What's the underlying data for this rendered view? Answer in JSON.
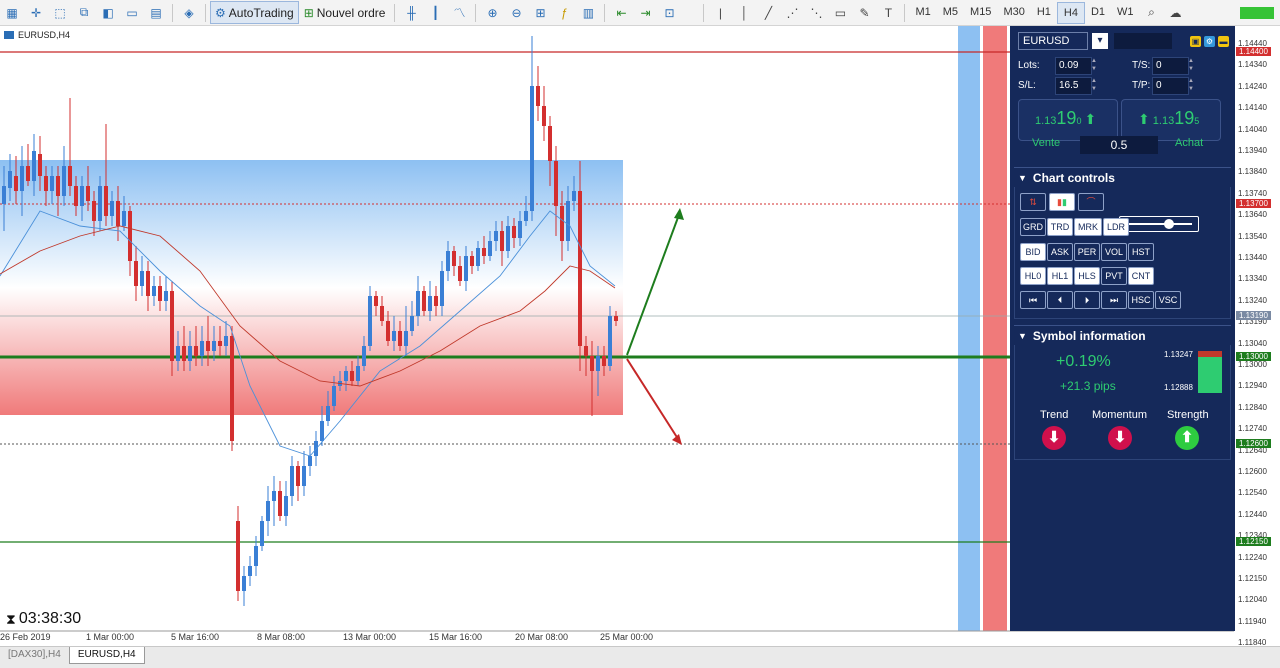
{
  "toolbar": {
    "autotrading_label": "AutoTrading",
    "new_order_label": "Nouvel ordre",
    "timeframes": [
      "M1",
      "M5",
      "M15",
      "M30",
      "H1",
      "H4",
      "D1",
      "W1"
    ],
    "active_timeframe": "H4"
  },
  "chart": {
    "title": "EURUSD,H4",
    "timer": "03:38:30",
    "y_ticks": [
      "1.14440",
      "1.14340",
      "1.14240",
      "1.14140",
      "1.14040",
      "1.13940",
      "1.13840",
      "1.13740",
      "1.13640",
      "1.13540",
      "1.13440",
      "1.13340",
      "1.13240",
      "1.13190",
      "1.13040",
      "1.13000",
      "1.12940",
      "1.12840",
      "1.12740",
      "1.12640",
      "1.12600",
      "1.12540",
      "1.12440",
      "1.12340",
      "1.12240",
      "1.12150",
      "1.12040",
      "1.11940",
      "1.11840"
    ],
    "labels": {
      "top_red": "1.14400",
      "mid_red": "1.13700",
      "current": "1.13190",
      "green": "1.13000",
      "lower_green": "1.12600",
      "bottom_green": "1.12150"
    },
    "x_ticks": [
      "26 Feb 2019",
      "1 Mar 00:00",
      "5 Mar 16:00",
      "8 Mar 08:00",
      "13 Mar 00:00",
      "15 Mar 16:00",
      "20 Mar 08:00",
      "25 Mar 00:00"
    ],
    "colors": {
      "bull": "#3a7fd5",
      "bear": "#d32f2f",
      "blue_zone": "#8dc0f2",
      "red_zone": "#f07a7a",
      "green_line": "#1e7d1e"
    }
  },
  "panel": {
    "symbol": "EURUSD",
    "lots_label": "Lots:",
    "lots": "0.09",
    "ts_label": "T/S:",
    "ts": "0",
    "sl_label": "S/L:",
    "sl": "16.5",
    "tp_label": "T/P:",
    "tp": "0",
    "sell_prefix": "1.13",
    "sell_big": "19",
    "sell_small": "0",
    "buy_prefix": "1.13",
    "buy_big": "19",
    "buy_small": "5",
    "sell_label": "Vente",
    "buy_label": "Achat",
    "lot_size": "0.5",
    "chart_controls_title": "Chart controls",
    "controls_row2": [
      "GRD",
      "TRD",
      "MRK",
      "LDR"
    ],
    "controls_row3": [
      "BID",
      "ASK",
      "PER",
      "VOL",
      "HST"
    ],
    "controls_row4": [
      "HL0",
      "HL1",
      "HLS",
      "PVT",
      "CNT"
    ],
    "controls_row5": [
      "⏮",
      "⏴",
      "⏵",
      "⏭",
      "HSC",
      "VSC"
    ],
    "symbol_info_title": "Symbol information",
    "change_pct": "+0.19%",
    "change_pips": "+21.3 pips",
    "high": "1.13247",
    "low": "1.12888",
    "trend_label": "Trend",
    "momentum_label": "Momentum",
    "strength_label": "Strength"
  },
  "tabs": [
    "[DAX30],H4",
    "EURUSD,H4"
  ]
}
